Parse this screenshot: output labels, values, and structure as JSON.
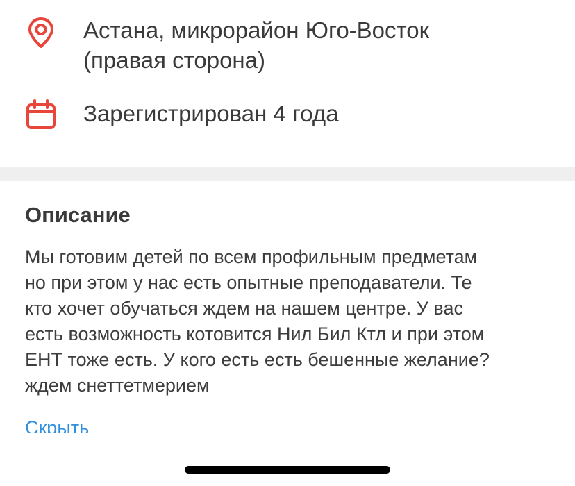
{
  "colors": {
    "icon_accent": "#e8463b",
    "link": "#2f8fe0",
    "divider": "#efefef"
  },
  "location": {
    "icon": "location-pin-icon",
    "text": "Астана, микрорайон Юго-Восток\n(правая сторона)"
  },
  "registered": {
    "icon": "calendar-icon",
    "text": "Зарегистрирован 4 года"
  },
  "description": {
    "title": "Описание",
    "text": "Мы готовим детей по всем профильным предметам\nно при этом у нас есть опытные преподаватели. Те\nкто хочет обучаться ждем на нашем центре. У вас\nесть возможность котовится Нил Бил Ктл и при этом\nЕНТ тоже есть. У кого есть есть бешенные желание?\nждем снеттетмерием",
    "hide_label": "Скрыть"
  }
}
